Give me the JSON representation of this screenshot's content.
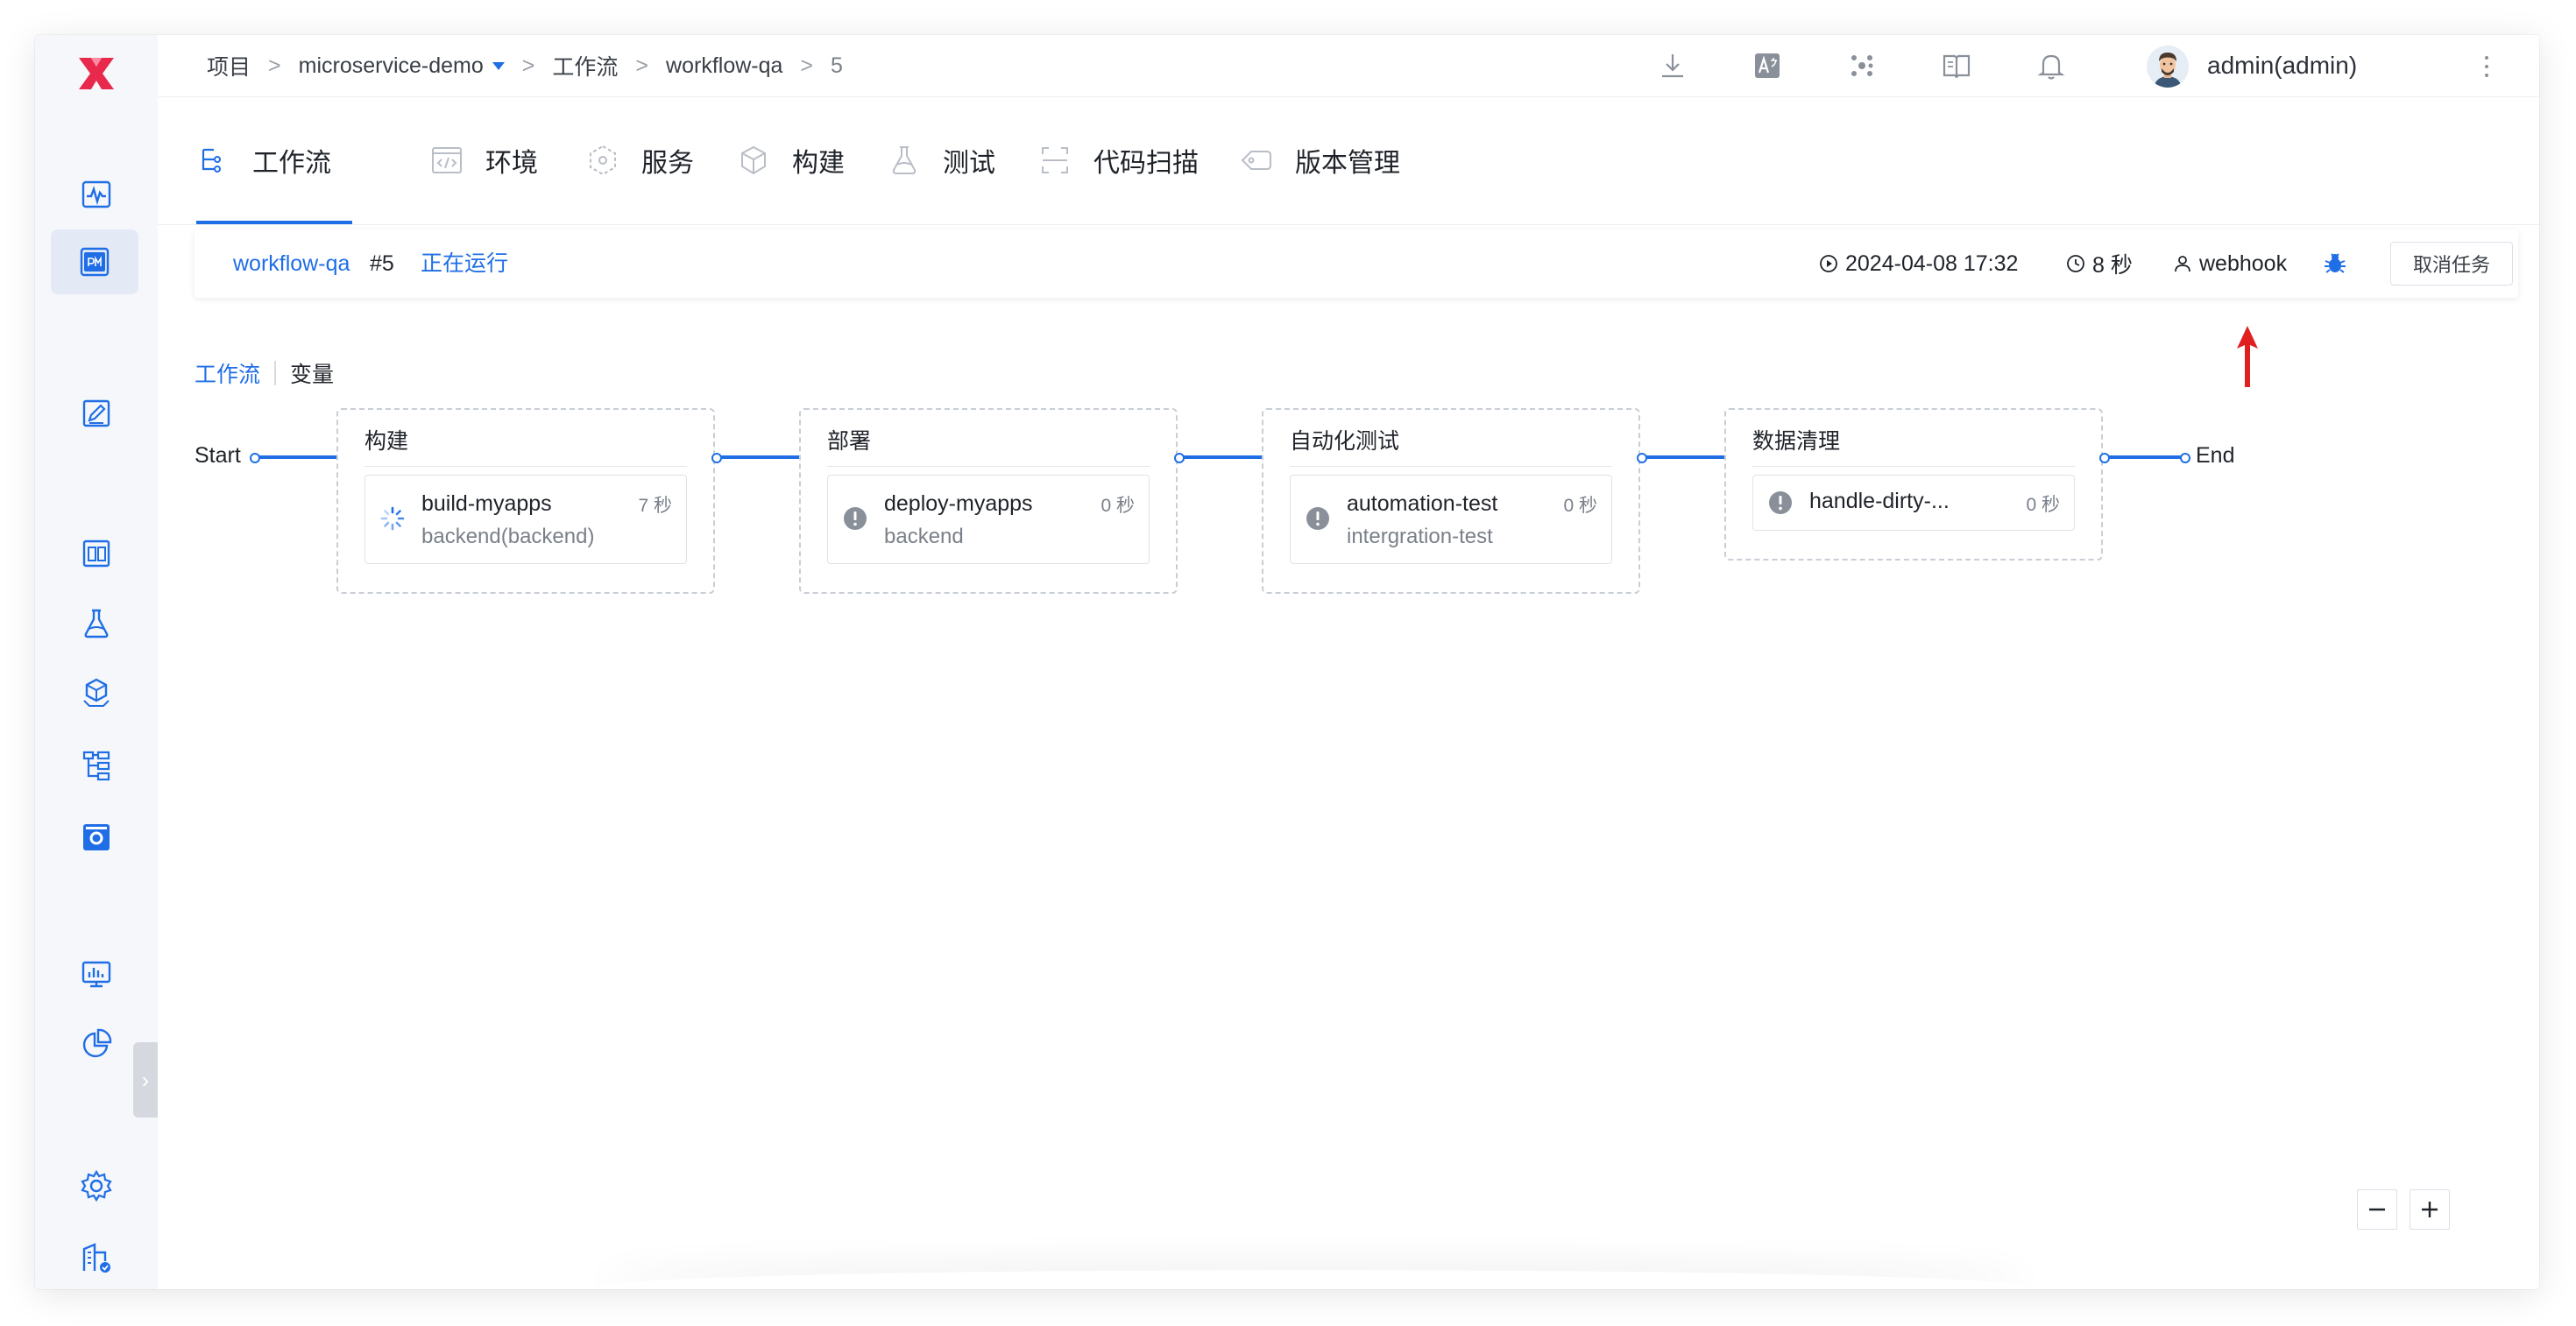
{
  "breadcrumb": [
    "项目",
    "microservice-demo",
    "工作流",
    "workflow-qa",
    "5"
  ],
  "user": {
    "name": "admin(admin)"
  },
  "tabs": [
    {
      "label": "工作流",
      "icon": "workflow-icon"
    },
    {
      "label": "环境",
      "icon": "code-icon"
    },
    {
      "label": "服务",
      "icon": "service-icon"
    },
    {
      "label": "构建",
      "icon": "cube-icon"
    },
    {
      "label": "测试",
      "icon": "flask-icon"
    },
    {
      "label": "代码扫描",
      "icon": "scan-icon"
    },
    {
      "label": "版本管理",
      "icon": "tag-icon"
    }
  ],
  "run": {
    "workflow": "workflow-qa",
    "number": "#5",
    "status": "正在运行",
    "start_time": "2024-04-08 17:32",
    "duration": "8 秒",
    "trigger": "webhook",
    "cancel_label": "取消任务"
  },
  "subtabs": [
    "工作流",
    "变量"
  ],
  "pipeline": {
    "start_label": "Start",
    "end_label": "End",
    "stages": [
      {
        "title": "构建",
        "job": {
          "name": "build-myapps",
          "sub": "backend(backend)",
          "time": "7 秒",
          "status": "running"
        }
      },
      {
        "title": "部署",
        "job": {
          "name": "deploy-myapps",
          "sub": "backend",
          "time": "0 秒",
          "status": "waiting"
        }
      },
      {
        "title": "自动化测试",
        "job": {
          "name": "automation-test",
          "sub": "intergration-test",
          "time": "0 秒",
          "status": "waiting"
        }
      },
      {
        "title": "数据清理",
        "job": {
          "name": "handle-dirty-...",
          "sub": "",
          "time": "0 秒",
          "status": "waiting"
        }
      }
    ]
  },
  "colors": {
    "accent": "#1f6ee6",
    "logo": "#e8294c",
    "arrow": "#e02020"
  }
}
